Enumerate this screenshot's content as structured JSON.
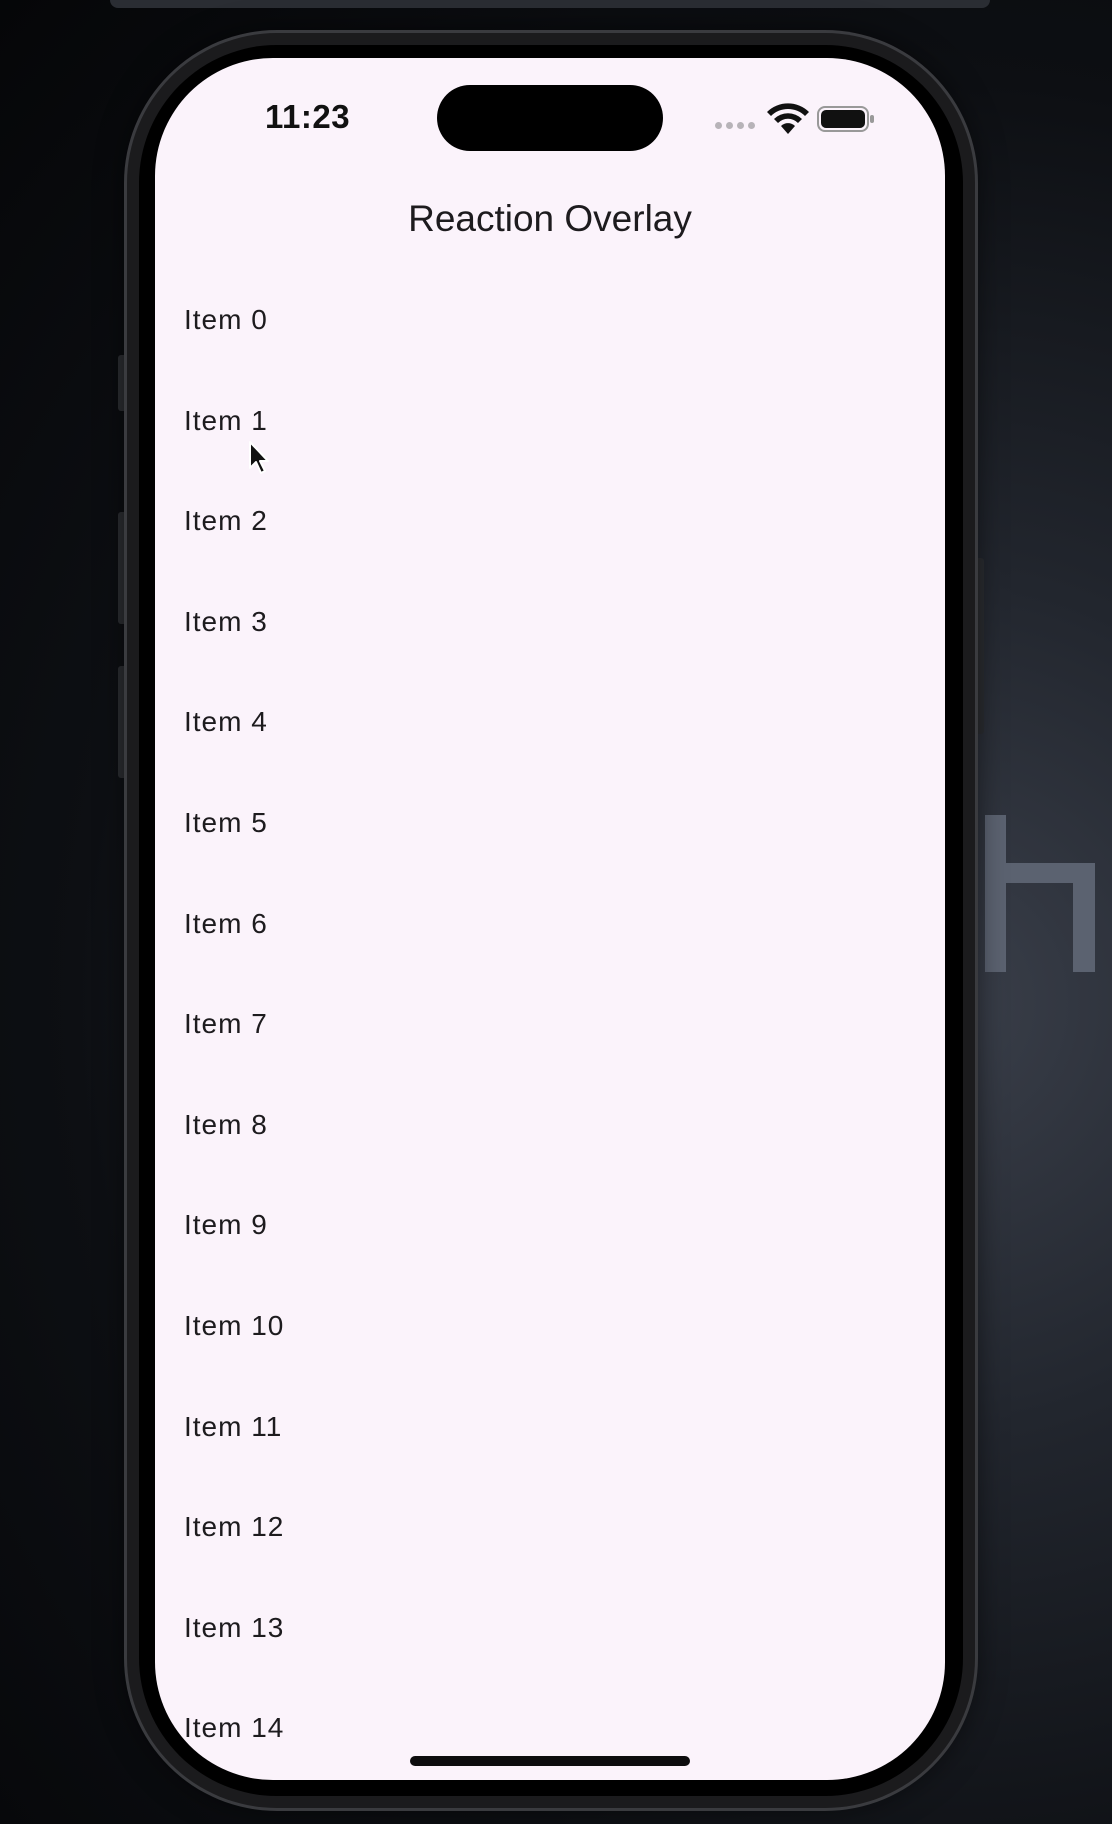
{
  "status_bar": {
    "time": "11:23",
    "icons": [
      "signal-dots-icon",
      "wifi-icon",
      "battery-icon"
    ]
  },
  "nav": {
    "title": "Reaction Overlay"
  },
  "list": {
    "items": [
      "Item 0",
      "Item 1",
      "Item 2",
      "Item 3",
      "Item 4",
      "Item 5",
      "Item 6",
      "Item 7",
      "Item 8",
      "Item 9",
      "Item 10",
      "Item 11",
      "Item 12",
      "Item 13",
      "Item 14"
    ]
  },
  "colors": {
    "screen_background": "#fbf3fb",
    "text": "#1d1b1e",
    "device_frame": "#1b1b1d"
  }
}
